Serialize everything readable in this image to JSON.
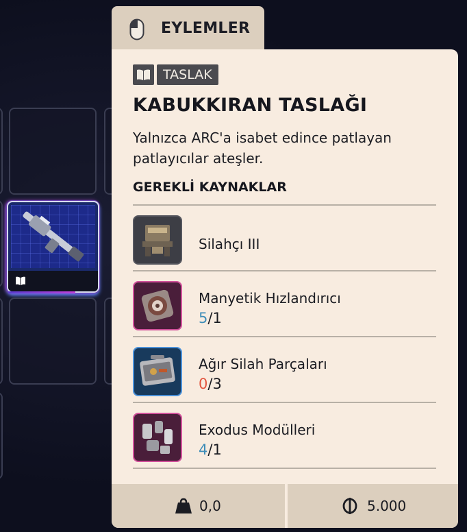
{
  "actions_tab": {
    "label": "EYLEMLER",
    "icon": "mouse-icon"
  },
  "item": {
    "category_icon": "blueprint-book-icon",
    "category": "TASLAK",
    "title": "KABUKKIRAN TASLAĞI",
    "description": "Yalnızca ARC'a isabet edince patlayan patlayıcılar ateşler.",
    "requirements_heading": "GEREKLİ KAYNAKLAR",
    "requirements": [
      {
        "name": "Silahçı III",
        "icon": "workbench-icon",
        "have": "",
        "need": "",
        "frame_color": "#55565e"
      },
      {
        "name": "Manyetik Hızlandırıcı",
        "icon": "magnetic-accelerator-icon",
        "have": "5",
        "need": "/1",
        "frame_color": "#d0509a",
        "have_color": "#3f8db8"
      },
      {
        "name": "Ağır Silah Parçaları",
        "icon": "weapon-parts-case-icon",
        "have": "0",
        "need": "/3",
        "frame_color": "#4a90d8",
        "have_color": "#e2553f"
      },
      {
        "name": "Exodus Modülleri",
        "icon": "exodus-modules-icon",
        "have": "4",
        "need": "/1",
        "frame_color": "#d0509a",
        "have_color": "#3f8db8"
      }
    ],
    "weight_icon": "weight-icon",
    "weight": "0,0",
    "value_icon": "coin-icon",
    "value": "5.000"
  },
  "inventory": {
    "selected_slot_icon": "shotgun-blueprint-icon",
    "selected_slot_badge_icon": "blueprint-book-icon"
  },
  "colors": {
    "card_bg": "#f8ece0",
    "tab_bg": "#dccfbe",
    "have_ok": "#3f8db8",
    "have_bad": "#e2553f"
  }
}
